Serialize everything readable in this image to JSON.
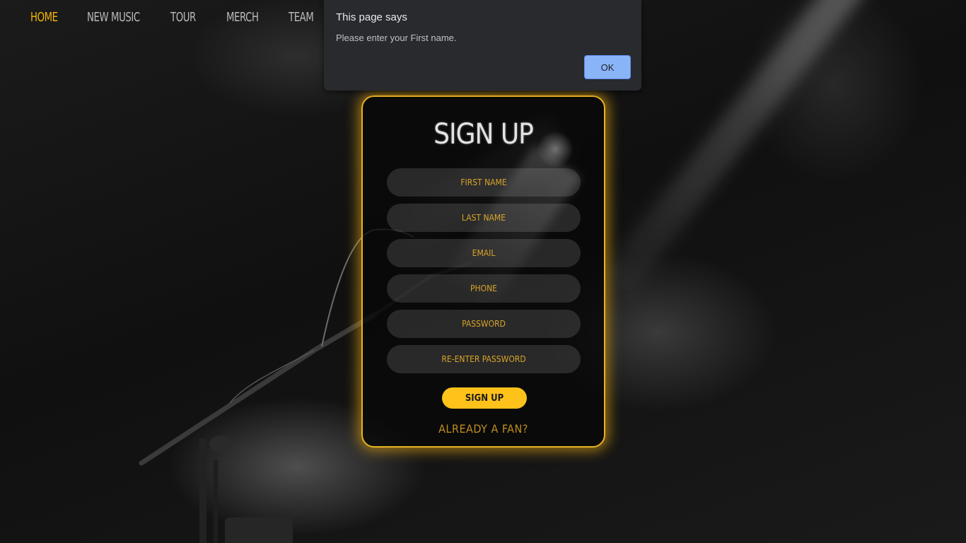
{
  "nav": {
    "items": [
      {
        "label": "HOME",
        "active": true
      },
      {
        "label": "NEW MUSIC",
        "active": false
      },
      {
        "label": "TOUR",
        "active": false
      },
      {
        "label": "MERCH",
        "active": false
      },
      {
        "label": "TEAM",
        "active": false
      }
    ]
  },
  "signup": {
    "title": "SIGN UP",
    "fields": {
      "first_name": "FIRST NAME",
      "last_name": "LAST NAME",
      "email": "EMAIL",
      "phone": "PHONE",
      "password": "PASSWORD",
      "reenter_password": "RE-ENTER PASSWORD"
    },
    "submit_label": "SIGN UP",
    "fan_link": "ALREADY A FAN?"
  },
  "dialog": {
    "title": "This page says",
    "message": "Please enter your First name.",
    "ok_label": "OK"
  },
  "colors": {
    "accent": "#f4b400",
    "button": "#ffc21a",
    "card_border": "#e9b322",
    "dialog_button": "#8ab4f8"
  }
}
